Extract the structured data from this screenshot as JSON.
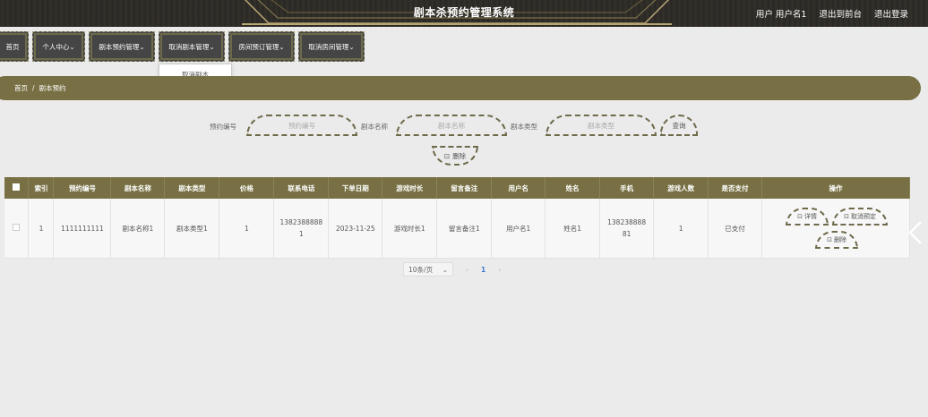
{
  "header": {
    "title": "剧本杀预约管理系统",
    "user_label": "用户 用户名1",
    "to_front": "退出到前台",
    "logout": "退出登录"
  },
  "nav": {
    "items": [
      {
        "label": "首页"
      },
      {
        "label": "个人中心"
      },
      {
        "label": "剧本预约管理"
      },
      {
        "label": "取消剧本管理"
      },
      {
        "label": "房间预订管理"
      },
      {
        "label": "取消房间管理"
      }
    ],
    "dropdown_item": "取消剧本"
  },
  "breadcrumb": {
    "home": "首页",
    "sep": "/",
    "current": "剧本预约"
  },
  "search": {
    "field1_label": "预约编号",
    "field1_placeholder": "预约编号",
    "field2_label": "剧本名称",
    "field2_placeholder": "剧本名称",
    "field3_label": "剧本类型",
    "field3_placeholder": "剧本类型",
    "query_button": "查询",
    "delete_button": "删除"
  },
  "table": {
    "headers": [
      "索引",
      "预约编号",
      "剧本名称",
      "剧本类型",
      "价格",
      "联系电话",
      "下单日期",
      "游戏时长",
      "留言备注",
      "用户名",
      "姓名",
      "手机",
      "游戏人数",
      "是否支付",
      "操作"
    ],
    "rows": [
      {
        "index": "1",
        "order_no": "1111111111",
        "script_name": "剧本名称1",
        "script_type": "剧本类型1",
        "price": "1",
        "contact_phone": "13823888881",
        "order_date": "2023-11-25",
        "duration": "游戏时长1",
        "remark": "留言备注1",
        "username": "用户名1",
        "name": "姓名1",
        "mobile": "13823888881",
        "players": "1",
        "paid": "已支付",
        "op_detail": "详情",
        "op_cancel": "取消预定",
        "op_delete": "删除"
      }
    ]
  },
  "pager": {
    "size": "10条/页",
    "current": "1"
  },
  "colors": {
    "accent": "#787044",
    "nav_bg": "#454545",
    "header_bg": "#2a2825"
  }
}
